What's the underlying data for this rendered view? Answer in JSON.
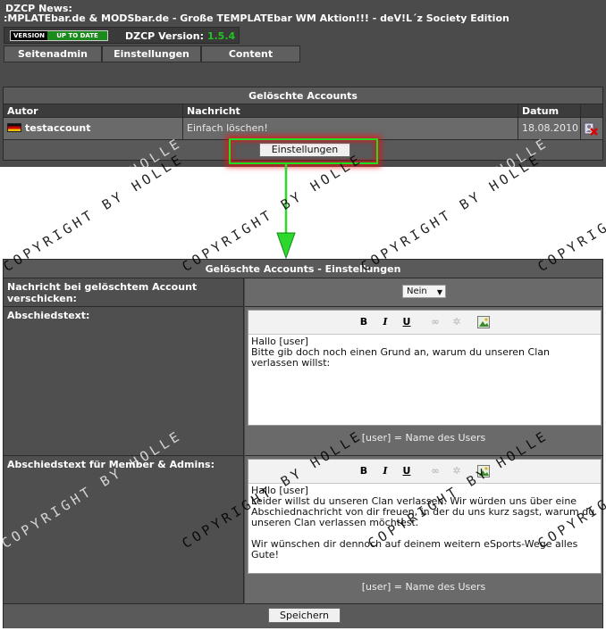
{
  "news": {
    "label": "DZCP News:",
    "text": ":MPLATEbar.de & MODSbar.de - Große TEMPLATEbar WM Aktion!!! - deV!L´z Society Edition"
  },
  "version": {
    "badge_version": "VERSION",
    "badge_status": "UP TO DATE",
    "label": "DZCP Version:",
    "number": "1.5.4"
  },
  "nav": [
    "Seitenadmin",
    "Einstellungen",
    "Content"
  ],
  "deleted_table": {
    "title": "Gelöschte Accounts",
    "columns": [
      "Autor",
      "Nachricht",
      "Datum"
    ],
    "rows": [
      {
        "autor": "testaccount",
        "nachricht": "Einfach löschen!",
        "datum": "18.08.2010"
      }
    ],
    "settings_button": "Einstellungen"
  },
  "settings": {
    "title": "Gelöschte Accounts - Einstellungen",
    "notify_label": "Nachricht bei gelöschtem Account verschicken:",
    "notify_value": "Nein",
    "farewell_label": "Abschiedstext:",
    "farewell_text": "Hallo [user]\nBitte gib doch noch einen Grund an, warum du unseren Clan\nverlassen willst:",
    "farewell_hint": "[user] = Name des Users",
    "member_label": "Abschiedstext für Member & Admins:",
    "member_text": "Hallo [user]\nLeider willst du unseren Clan verlassen. Wir würden uns über eine\nAbschiednachricht von dir freuen, in der du uns kurz sagst, warum du\nunseren Clan verlassen möchtest.\n\nWir wünschen dir dennoch auf deinem weitern eSports-Wege alles\nGute!",
    "member_hint": "[user] = Name des Users",
    "save_button": "Speichern"
  },
  "toolbar": {
    "bold": "B",
    "italic": "I",
    "underline": "U"
  },
  "watermark": "COPYRIGHT BY HOLLE",
  "colors": {
    "highlight": "#1ee01e",
    "glow": "#e61414",
    "version_ok": "#23c223"
  }
}
